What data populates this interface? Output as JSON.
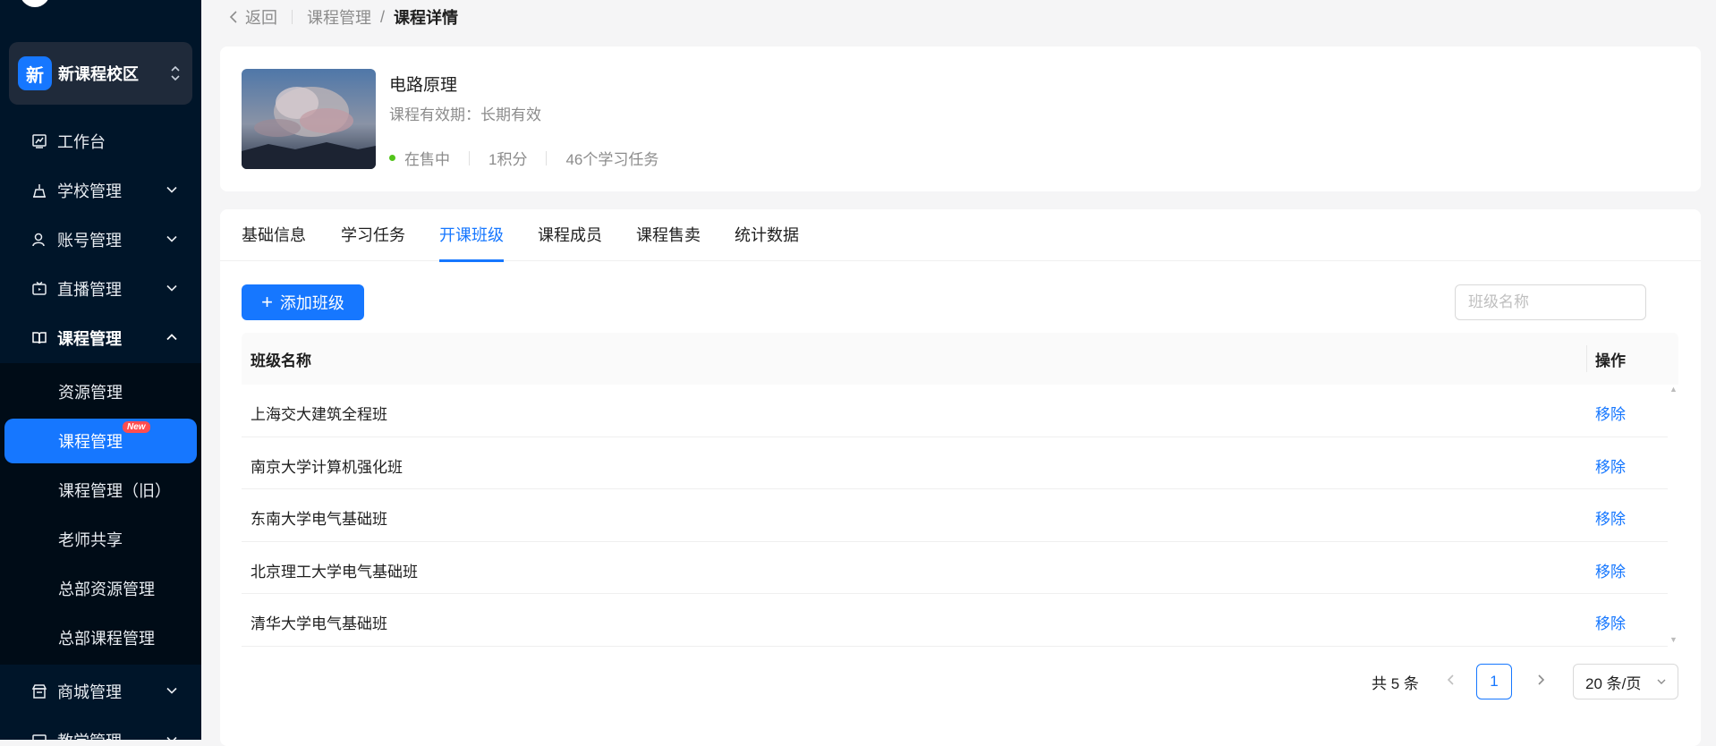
{
  "sidebar": {
    "campus": {
      "badge": "新",
      "name": "新课程校区"
    },
    "menu": [
      {
        "label": "工作台"
      },
      {
        "label": "学校管理"
      },
      {
        "label": "账号管理"
      },
      {
        "label": "直播管理"
      },
      {
        "label": "课程管理"
      },
      {
        "label": "商城管理"
      },
      {
        "label": "教学管理"
      }
    ],
    "submenu": [
      {
        "label": "资源管理"
      },
      {
        "label": "课程管理",
        "badge": "New"
      },
      {
        "label": "课程管理（旧）"
      },
      {
        "label": "老师共享"
      },
      {
        "label": "总部资源管理"
      },
      {
        "label": "总部课程管理"
      }
    ]
  },
  "breadcrumb": {
    "back": "返回",
    "parent": "课程管理",
    "separator": "/",
    "current": "课程详情"
  },
  "course": {
    "title": "电路原理",
    "validity": "课程有效期：长期有效",
    "status": "在售中",
    "points": "1积分",
    "tasks": "46个学习任务"
  },
  "tabs": [
    {
      "label": "基础信息"
    },
    {
      "label": "学习任务"
    },
    {
      "label": "开课班级",
      "active": true
    },
    {
      "label": "课程成员"
    },
    {
      "label": "课程售卖"
    },
    {
      "label": "统计数据"
    }
  ],
  "toolbar": {
    "add_label": "添加班级",
    "search_placeholder": "班级名称"
  },
  "table": {
    "headers": {
      "name": "班级名称",
      "action": "操作"
    },
    "rows": [
      {
        "name": "上海交大建筑全程班",
        "action": "移除"
      },
      {
        "name": "南京大学计算机强化班",
        "action": "移除"
      },
      {
        "name": "东南大学电气基础班",
        "action": "移除"
      },
      {
        "name": "北京理工大学电气基础班",
        "action": "移除"
      },
      {
        "name": "清华大学电气基础班",
        "action": "移除"
      }
    ]
  },
  "pagination": {
    "total": "共 5 条",
    "current": "1",
    "page_size": "20 条/页"
  },
  "colors": {
    "primary": "#1677ff",
    "sidebar_bg": "#001529",
    "submenu_bg": "#000c17",
    "status_green": "#52c41a",
    "new_badge": "#ff4d4f"
  }
}
